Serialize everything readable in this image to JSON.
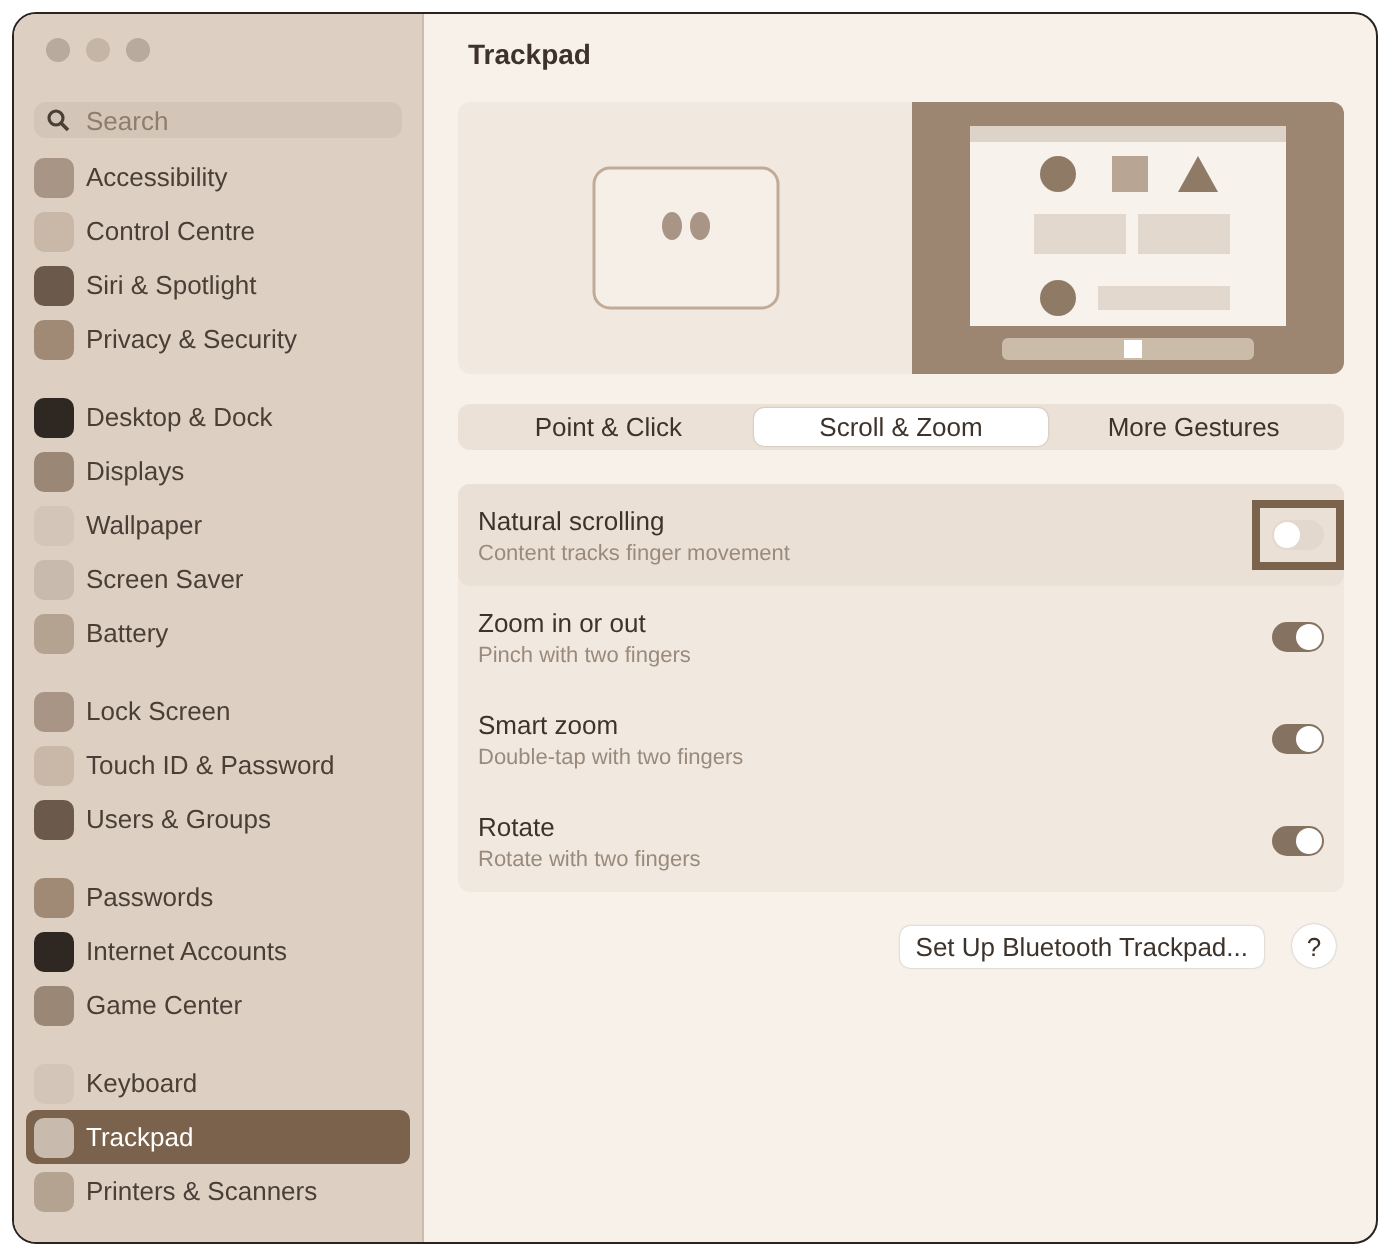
{
  "window": {
    "title": "Trackpad"
  },
  "sidebar": {
    "search": {
      "placeholder": "Search"
    },
    "groups": [
      {
        "items": [
          {
            "label": "Accessibility",
            "selected": false
          },
          {
            "label": "Control Centre",
            "selected": false
          },
          {
            "label": "Siri & Spotlight",
            "selected": false
          },
          {
            "label": "Privacy & Security",
            "selected": false
          }
        ]
      },
      {
        "items": [
          {
            "label": "Desktop & Dock",
            "selected": false
          },
          {
            "label": "Displays",
            "selected": false
          },
          {
            "label": "Wallpaper",
            "selected": false
          },
          {
            "label": "Screen Saver",
            "selected": false
          },
          {
            "label": "Battery",
            "selected": false
          }
        ]
      },
      {
        "items": [
          {
            "label": "Lock Screen",
            "selected": false
          },
          {
            "label": "Touch ID & Password",
            "selected": false
          },
          {
            "label": "Users & Groups",
            "selected": false
          }
        ]
      },
      {
        "items": [
          {
            "label": "Passwords",
            "selected": false
          },
          {
            "label": "Internet Accounts",
            "selected": false
          },
          {
            "label": "Game Center",
            "selected": false
          }
        ]
      },
      {
        "items": [
          {
            "label": "Keyboard",
            "selected": false
          },
          {
            "label": "Trackpad",
            "selected": true
          },
          {
            "label": "Printers & Scanners",
            "selected": false
          }
        ]
      }
    ]
  },
  "tabs": [
    {
      "label": "Point & Click",
      "selected": false
    },
    {
      "label": "Scroll & Zoom",
      "selected": true
    },
    {
      "label": "More Gestures",
      "selected": false
    }
  ],
  "settings": [
    {
      "title": "Natural scrolling",
      "subtitle": "Content tracks finger movement",
      "on": false,
      "highlighted": true
    },
    {
      "title": "Zoom in or out",
      "subtitle": "Pinch with two fingers",
      "on": true,
      "highlighted": false
    },
    {
      "title": "Smart zoom",
      "subtitle": "Double-tap with two fingers",
      "on": true,
      "highlighted": false
    },
    {
      "title": "Rotate",
      "subtitle": "Rotate with two fingers",
      "on": true,
      "highlighted": false
    }
  ],
  "setup_button": {
    "label": "Set Up Bluetooth Trackpad..."
  },
  "help_button": {
    "label": "?"
  }
}
